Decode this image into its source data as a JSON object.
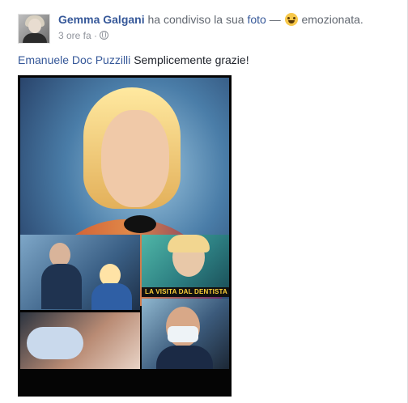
{
  "post": {
    "author": "Gemma Galgani",
    "action_text": "ha condiviso la sua",
    "object_link": "foto",
    "separator": "—",
    "feeling_icon": "smiling-emoji-icon",
    "feeling": "emozionata.",
    "timestamp": "3 ore fa",
    "dot": "·",
    "privacy_icon": "globe-icon",
    "mention": "Emanuele Doc Puzzilli",
    "message": "Semplicemente grazie!",
    "photo_banner": "LA VISITA DAL DENTISTA"
  },
  "colors": {
    "link": "#365899",
    "secondary_text": "#616770",
    "meta_text": "#90949c"
  }
}
